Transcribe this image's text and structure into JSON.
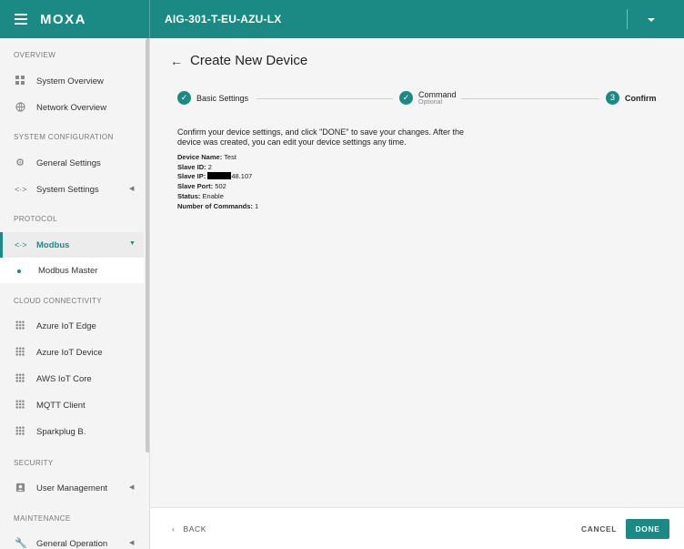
{
  "header": {
    "logo": "MOXA",
    "device_title": "AIG-301-T-EU-AZU-LX"
  },
  "sidebar": {
    "sections": {
      "overview": "OVERVIEW",
      "system_configuration": "SYSTEM CONFIGURATION",
      "protocol": "PROTOCOL",
      "cloud_connectivity": "CLOUD CONNECTIVITY",
      "security": "SECURITY",
      "maintenance": "MAINTENANCE"
    },
    "items": {
      "system_overview": "System Overview",
      "network_overview": "Network Overview",
      "general_settings": "General Settings",
      "system_settings": "System Settings",
      "modbus": "Modbus",
      "modbus_master": "Modbus Master",
      "azure_iot_edge": "Azure IoT Edge",
      "azure_iot_device": "Azure IoT Device",
      "aws_iot_core": "AWS IoT Core",
      "mqtt_client": "MQTT Client",
      "sparkplug": "Sparkplug B.",
      "user_management": "User Management",
      "general_operation": "General Operation"
    }
  },
  "main": {
    "title": "Create New Device",
    "steps": [
      {
        "label": "Basic Settings",
        "state": "done"
      },
      {
        "label": "Command",
        "sublabel": "Optional",
        "state": "done"
      },
      {
        "number": "3",
        "label": "Confirm",
        "state": "active"
      }
    ],
    "description": "Confirm your device settings, and click \"DONE\" to save your changes. After the device was created, you can edit your device settings any time.",
    "details": {
      "device_name_label": "Device Name:",
      "device_name": "Test",
      "slave_id_label": "Slave ID:",
      "slave_id": "2",
      "slave_ip_label": "Slave IP:",
      "slave_ip_visible": "48.107",
      "slave_port_label": "Slave Port:",
      "slave_port": "502",
      "status_label": "Status:",
      "status": "Enable",
      "num_commands_label": "Number of Commands:",
      "num_commands": "1"
    }
  },
  "footer": {
    "back": "BACK",
    "cancel": "CANCEL",
    "done": "DONE"
  },
  "colors": {
    "accent": "#1b8a84"
  }
}
